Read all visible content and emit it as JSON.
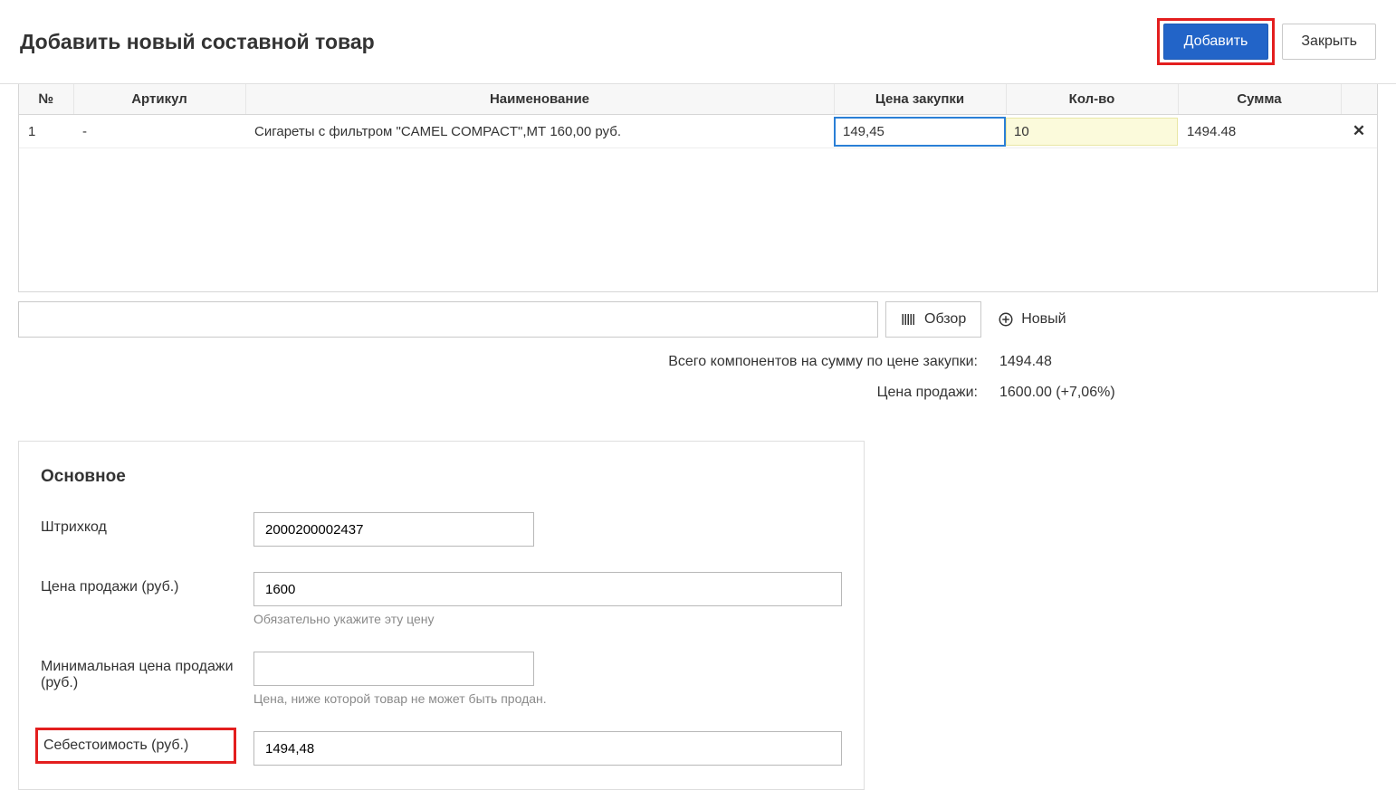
{
  "header": {
    "title": "Добавить новый составной товар",
    "add_label": "Добавить",
    "close_label": "Закрыть"
  },
  "grid": {
    "columns": {
      "num": "№",
      "sku": "Артикул",
      "name": "Наименование",
      "price": "Цена закупки",
      "qty": "Кол-во",
      "sum": "Сумма"
    },
    "rows": [
      {
        "num": "1",
        "sku": "-",
        "name": "Сигареты с фильтром \"CAMEL COMPACT\",МТ 160,00 руб.",
        "price": "149,45",
        "qty": "10",
        "sum": "1494.48"
      }
    ]
  },
  "bar": {
    "browse_label": "Обзор",
    "new_label": "Новый"
  },
  "summary": {
    "total_label": "Всего компонентов на сумму по цене закупки:",
    "total_value": "1494.48",
    "sale_label": "Цена продажи:",
    "sale_value": "1600.00 (+7,06%)"
  },
  "panel": {
    "title": "Основное",
    "barcode_label": "Штрихкод",
    "barcode_value": "2000200002437",
    "saleprice_label": "Цена продажи (руб.)",
    "saleprice_value": "1600",
    "saleprice_hint": "Обязательно укажите эту цену",
    "minprice_label": "Минимальная цена продажи (руб.)",
    "minprice_value": "",
    "minprice_hint": "Цена, ниже которой товар не может быть продан.",
    "cost_label": "Себестоимость (руб.)",
    "cost_value": "1494,48"
  }
}
